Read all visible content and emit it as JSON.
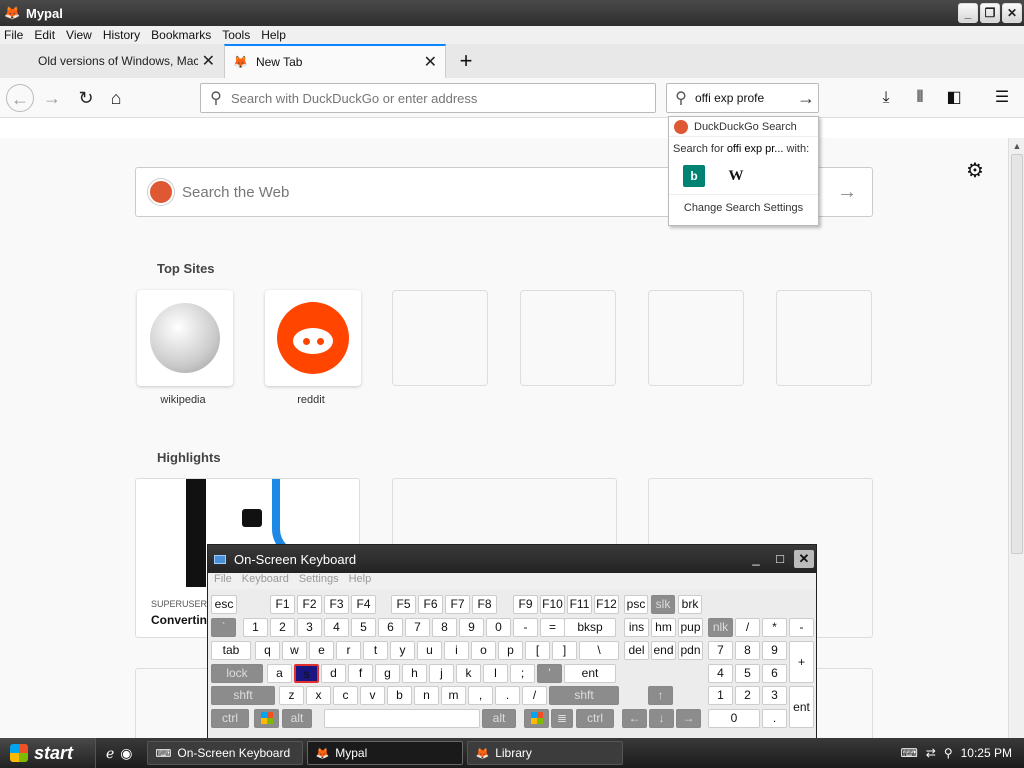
{
  "window": {
    "title": "Mypal"
  },
  "menubar": [
    "File",
    "Edit",
    "View",
    "History",
    "Bookmarks",
    "Tools",
    "Help"
  ],
  "tabs": [
    {
      "label": "Old versions of Windows, Mac and Linux"
    },
    {
      "label": "New Tab"
    }
  ],
  "navbar": {
    "url_placeholder": "Search with DuckDuckGo or enter address",
    "search_value": "offi exp profe"
  },
  "search_dropdown": {
    "engine": "DuckDuckGo Search",
    "search_for_prefix": "Search for ",
    "search_for_term": "offi exp pr...",
    "search_for_suffix": " with:",
    "engines": [
      "b",
      "W"
    ],
    "change_settings": "Change Search Settings"
  },
  "newtab": {
    "search_placeholder": "Search the Web",
    "top_sites_title": "Top Sites",
    "top_sites": [
      {
        "label": "wikipedia"
      },
      {
        "label": "reddit"
      }
    ],
    "highlights_title": "Highlights",
    "highlight": {
      "source": "SUPERUSER",
      "title": "Convertin"
    }
  },
  "osk": {
    "title": "On-Screen Keyboard",
    "menu": [
      "File",
      "Keyboard",
      "Settings",
      "Help"
    ],
    "rows": {
      "r1": [
        "esc",
        "F1",
        "F2",
        "F3",
        "F4",
        "F5",
        "F6",
        "F7",
        "F8",
        "F9",
        "F10",
        "F11",
        "F12",
        "psc",
        "slk",
        "brk"
      ],
      "r2": [
        "`",
        "1",
        "2",
        "3",
        "4",
        "5",
        "6",
        "7",
        "8",
        "9",
        "0",
        "-",
        "=",
        "bksp",
        "ins",
        "hm",
        "pup",
        "nlk",
        "/",
        "*",
        "-"
      ],
      "r3": [
        "tab",
        "q",
        "w",
        "e",
        "r",
        "t",
        "y",
        "u",
        "i",
        "o",
        "p",
        "[",
        "]",
        "\\",
        "del",
        "end",
        "pdn",
        "7",
        "8",
        "9",
        "+"
      ],
      "r4": [
        "lock",
        "a",
        "s",
        "d",
        "f",
        "g",
        "h",
        "j",
        "k",
        "l",
        ";",
        "'",
        "ent",
        "4",
        "5",
        "6"
      ],
      "r5": [
        "shft",
        "z",
        "x",
        "c",
        "v",
        "b",
        "n",
        "m",
        ",",
        ".",
        "/",
        "shft",
        "↑",
        "1",
        "2",
        "3",
        "ent"
      ],
      "r6": [
        "ctrl",
        "alt",
        "alt",
        "ctrl",
        "←",
        "↓",
        "→",
        "0",
        "."
      ]
    }
  },
  "taskbar": {
    "start": "start",
    "tasks": [
      "On-Screen Keyboard",
      "Mypal",
      "Library"
    ],
    "clock": "10:25 PM"
  },
  "colors": {
    "accent": "#0a84ff",
    "pressed_key": "#1a1580",
    "pressed_border": "#e03030"
  }
}
